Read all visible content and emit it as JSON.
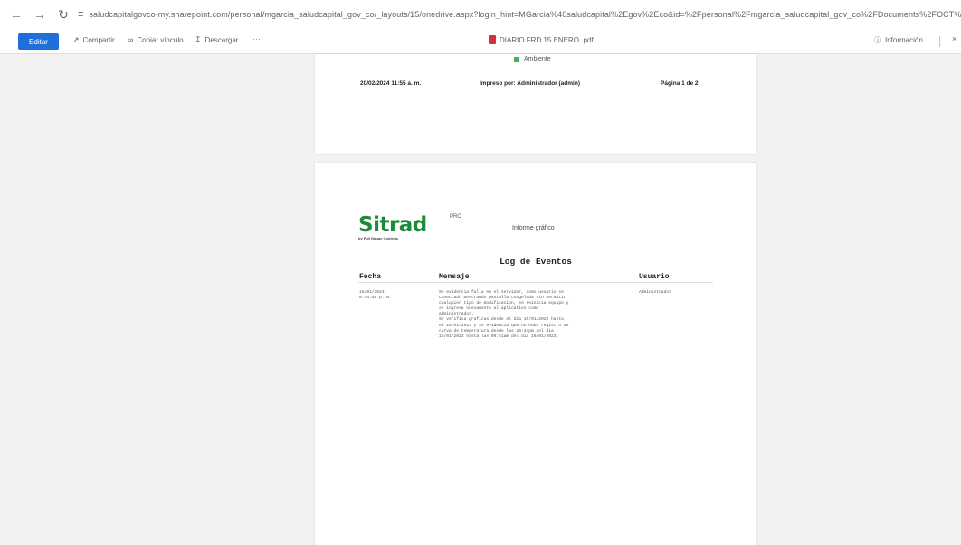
{
  "browser": {
    "url": "saludcapitalgovco-my.sharepoint.com/personal/mgarcia_saludcapital_gov_co/_layouts/15/onedrive.aspx?login_hint=MGarcia%40saludcapital%2Egov%2Eco&id=%2Fpersonal%2Fmgarcia_saludcapital_gov_co%2FDocuments%2FOCT%2FPAT%2FILN%3%20"
  },
  "toolbar": {
    "edit_label": "Editar",
    "share_label": "Compartir",
    "copy_link_label": "Copiar vínculo",
    "download_label": "Descargar",
    "more_label": "···",
    "file_name": "DIARIO FRD 15 ENERO .pdf",
    "info_label": "Información"
  },
  "page1": {
    "legend_label": "Ambiente",
    "legend_color": "#4caf50",
    "printed_at": "20/02/2024 11:55 a. m.",
    "printed_by": "Impreso por: Administrador (admin)",
    "page_number": "Página 1 de 2"
  },
  "page2": {
    "logo_text": "Sitrad",
    "logo_pro": "PRO",
    "logo_sub": "by Full Gauge Controls",
    "brand_color": "#1b8a3a",
    "report_title": "Informe gráfico",
    "log_title": "Log de Eventos",
    "columns": {
      "fecha": "Fecha",
      "mensaje": "Mensaje",
      "usuario": "Usuario"
    },
    "entry": {
      "date_line1": "15/01/2023",
      "date_line2": "8:44:58 p. m.",
      "message_lines": [
        "Se evidencia falla en el servidor, como usuario se",
        "conectado mostrando pantalla congelada sin permitir",
        "cualquier tipo de modificacion, se reinicia equipo y",
        "se ingresa nuevamente al aplicativo como",
        "administrador.",
        "Se verifica graficas desde el dia 15/01/2023 hasta",
        "el 16/01/2023 y se evidencia que no hubo registro de",
        "curva de temperatura desde las  20:44pm del dia",
        "15/01/2023 hasta las 09:51am del dia 16/01/2023."
      ],
      "user": "Administrador"
    }
  }
}
